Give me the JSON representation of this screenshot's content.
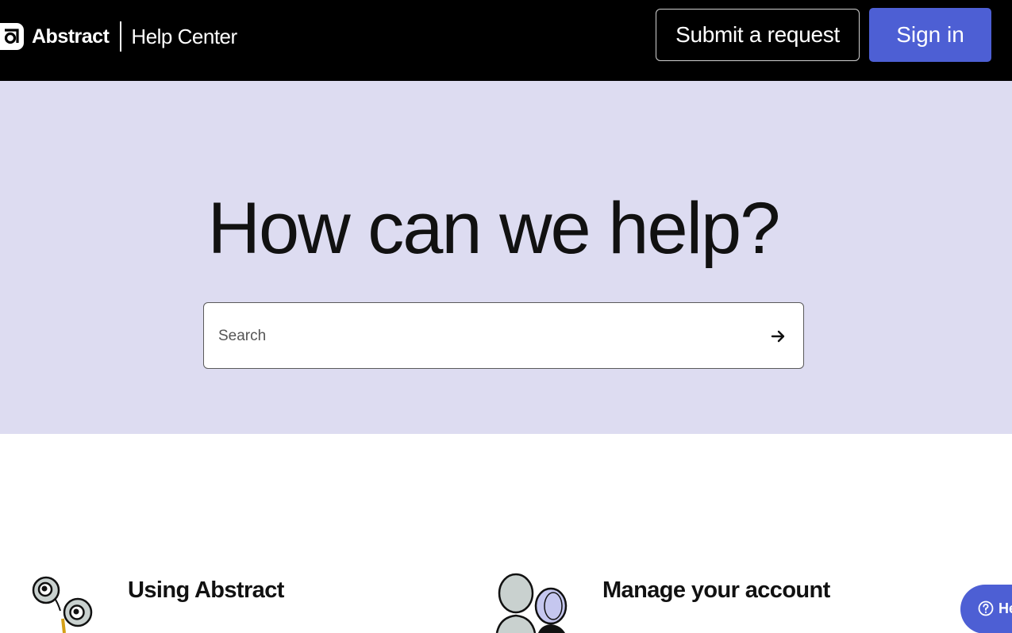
{
  "header": {
    "brand_name": "Abstract",
    "brand_sub": "Help Center",
    "submit_label": "Submit a request",
    "signin_label": "Sign in"
  },
  "hero": {
    "title": "How can we help?",
    "search_placeholder": "Search"
  },
  "categories": [
    {
      "title": "Using Abstract",
      "icon": "binoculars-icon"
    },
    {
      "title": "Manage your account",
      "icon": "people-icon"
    }
  ],
  "help_widget": {
    "label": "He"
  },
  "colors": {
    "header_bg": "#000000",
    "hero_bg": "#dddcf1",
    "accent": "#4d5fd4"
  }
}
